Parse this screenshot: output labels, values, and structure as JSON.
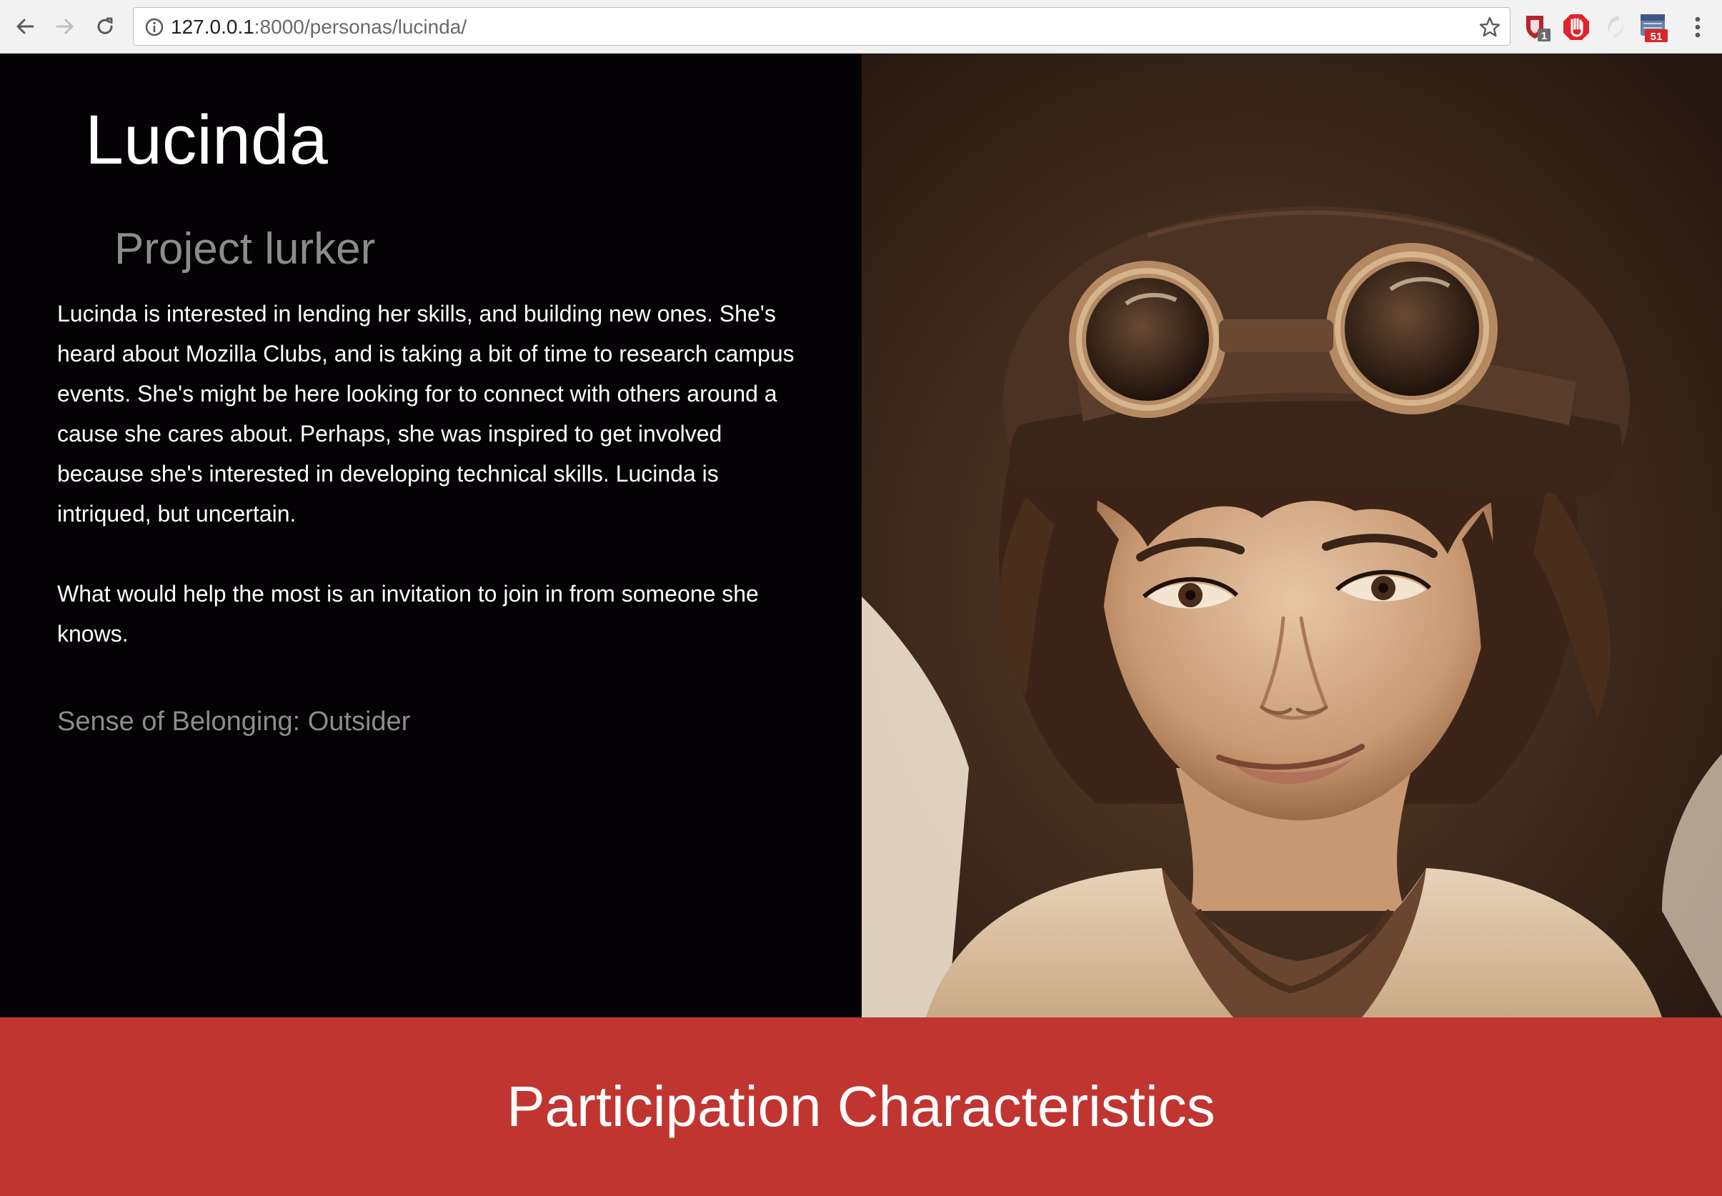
{
  "browser": {
    "url_host": "127.0.0.1",
    "url_rest": ":8000/personas/lucinda/",
    "extensions": [
      {
        "icon": "shield-extension-icon",
        "badge": "1"
      },
      {
        "icon": "stop-extension-icon"
      },
      {
        "icon": "gray-extension-icon"
      },
      {
        "icon": "calendar-extension-icon",
        "badge": "51"
      }
    ]
  },
  "persona": {
    "name": "Lucinda",
    "role": "Project lurker",
    "description": "Lucinda is interested in lending her skills, and building new ones. She's heard about Mozilla Clubs, and is taking a bit of time to research campus events. She's might be here looking for to connect with others around a cause she cares about. Perhaps, she was inspired to get involved because she's interested in developing technical skills. Lucinda is intriqued, but uncertain.",
    "help_text": "What would help the most is an invitation to join in from someone she knows.",
    "belonging": "Sense of Belonging: Outsider"
  },
  "section": {
    "title": "Participation Characteristics"
  },
  "colors": {
    "hero_background": "#040204",
    "accent_red": "#c13531",
    "muted_text": "#8c8c8c"
  }
}
